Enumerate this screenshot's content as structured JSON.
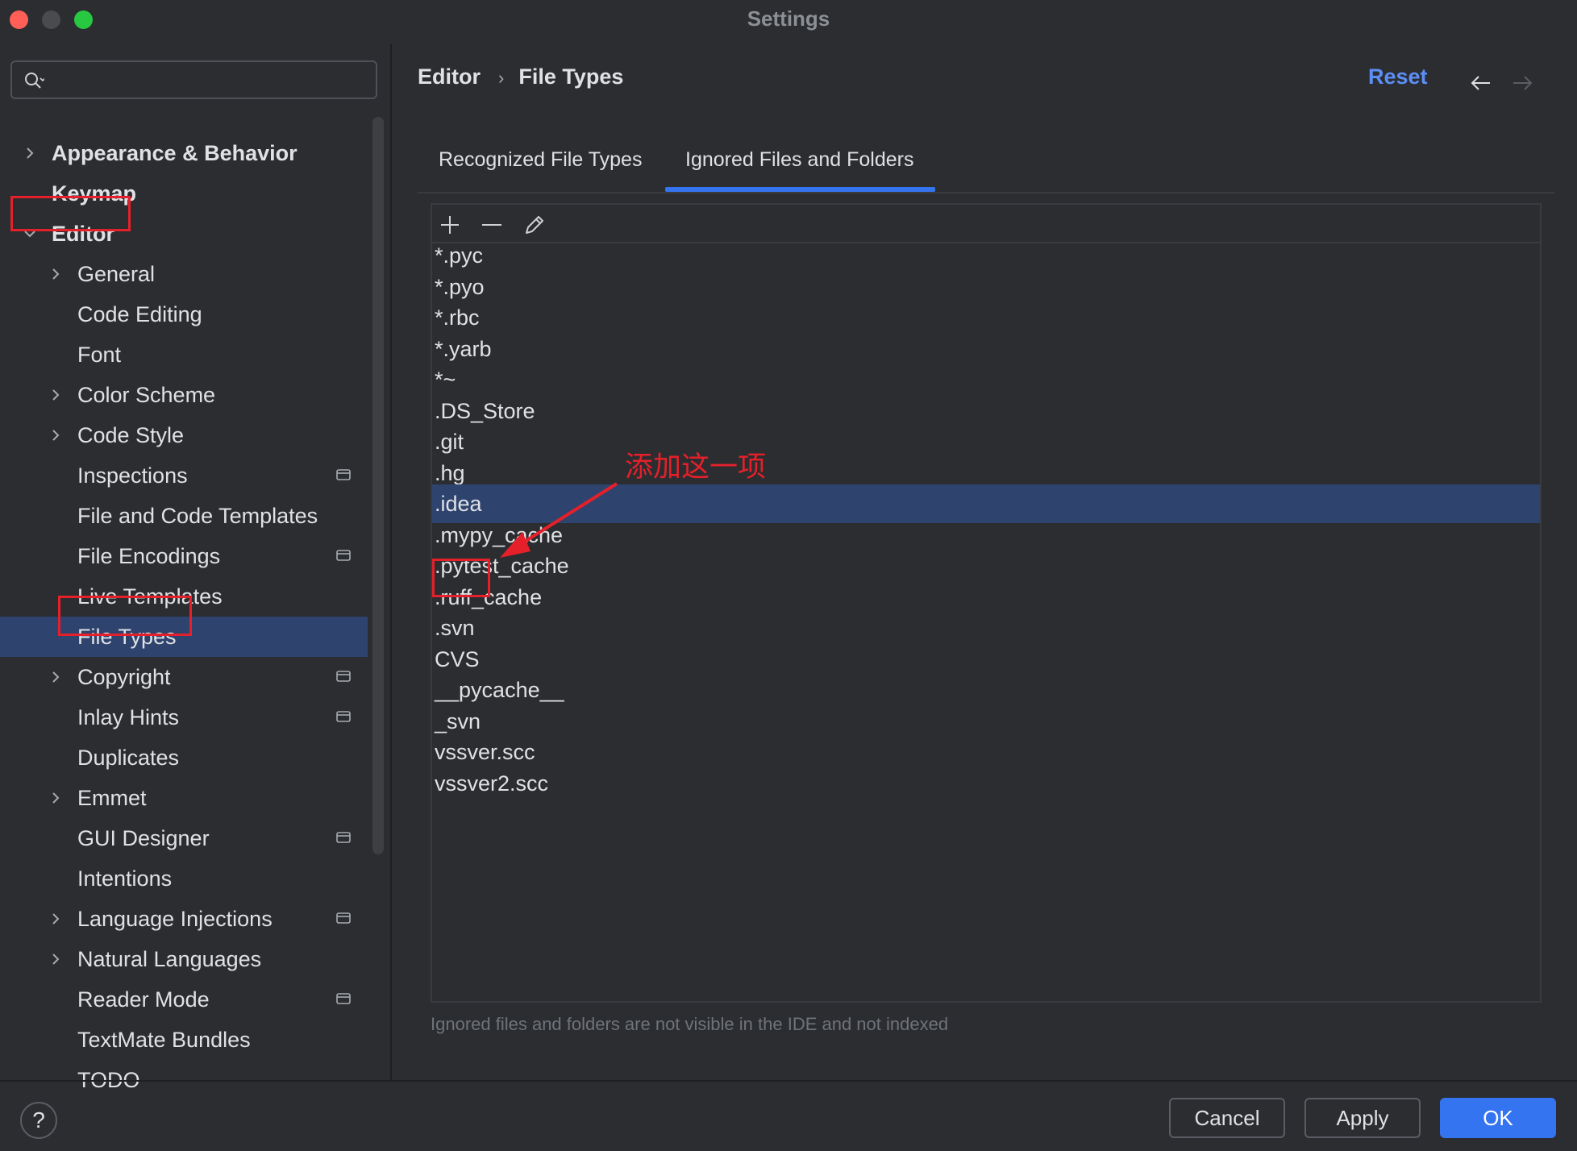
{
  "window": {
    "title": "Settings"
  },
  "search": {
    "placeholder": ""
  },
  "sidebar": {
    "items": [
      {
        "label": "Appearance & Behavior",
        "expandable": true,
        "expanded": false,
        "bold": true,
        "level": 0,
        "project_icon": false
      },
      {
        "label": "Keymap",
        "expandable": false,
        "bold": true,
        "level": 0,
        "project_icon": false
      },
      {
        "label": "Editor",
        "expandable": true,
        "expanded": true,
        "bold": true,
        "level": 0,
        "project_icon": false,
        "highlighted": true
      },
      {
        "label": "General",
        "expandable": true,
        "expanded": false,
        "level": 1,
        "project_icon": false
      },
      {
        "label": "Code Editing",
        "expandable": false,
        "level": 1,
        "project_icon": false
      },
      {
        "label": "Font",
        "expandable": false,
        "level": 1,
        "project_icon": false
      },
      {
        "label": "Color Scheme",
        "expandable": true,
        "expanded": false,
        "level": 1,
        "project_icon": false
      },
      {
        "label": "Code Style",
        "expandable": true,
        "expanded": false,
        "level": 1,
        "project_icon": false
      },
      {
        "label": "Inspections",
        "expandable": false,
        "level": 1,
        "project_icon": true
      },
      {
        "label": "File and Code Templates",
        "expandable": false,
        "level": 1,
        "project_icon": false
      },
      {
        "label": "File Encodings",
        "expandable": false,
        "level": 1,
        "project_icon": true
      },
      {
        "label": "Live Templates",
        "expandable": false,
        "level": 1,
        "project_icon": false
      },
      {
        "label": "File Types",
        "expandable": false,
        "level": 1,
        "project_icon": false,
        "selected": true,
        "highlighted": true
      },
      {
        "label": "Copyright",
        "expandable": true,
        "expanded": false,
        "level": 1,
        "project_icon": true
      },
      {
        "label": "Inlay Hints",
        "expandable": false,
        "level": 1,
        "project_icon": true
      },
      {
        "label": "Duplicates",
        "expandable": false,
        "level": 1,
        "project_icon": false
      },
      {
        "label": "Emmet",
        "expandable": true,
        "expanded": false,
        "level": 1,
        "project_icon": false
      },
      {
        "label": "GUI Designer",
        "expandable": false,
        "level": 1,
        "project_icon": true
      },
      {
        "label": "Intentions",
        "expandable": false,
        "level": 1,
        "project_icon": false
      },
      {
        "label": "Language Injections",
        "expandable": true,
        "expanded": false,
        "level": 1,
        "project_icon": true
      },
      {
        "label": "Natural Languages",
        "expandable": true,
        "expanded": false,
        "level": 1,
        "project_icon": false
      },
      {
        "label": "Reader Mode",
        "expandable": false,
        "level": 1,
        "project_icon": true
      },
      {
        "label": "TextMate Bundles",
        "expandable": false,
        "level": 1,
        "project_icon": false
      },
      {
        "label": "TODO",
        "expandable": false,
        "level": 1,
        "project_icon": false
      }
    ]
  },
  "header": {
    "breadcrumb": [
      "Editor",
      "File Types"
    ],
    "reset_label": "Reset",
    "back_icon": "arrow-left-icon",
    "forward_icon": "arrow-right-icon"
  },
  "tabs": [
    {
      "label": "Recognized File Types",
      "active": false
    },
    {
      "label": "Ignored Files and Folders",
      "active": true
    }
  ],
  "toolbar": {
    "buttons": [
      {
        "name": "add-button",
        "icon": "plus-icon"
      },
      {
        "name": "remove-button",
        "icon": "minus-icon"
      },
      {
        "name": "edit-button",
        "icon": "pencil-icon"
      }
    ]
  },
  "ignored_list": {
    "entries": [
      "*.pyc",
      "*.pyo",
      "*.rbc",
      "*.yarb",
      "*~",
      ".DS_Store",
      ".git",
      ".hg",
      ".idea",
      ".mypy_cache",
      ".pytest_cache",
      ".ruff_cache",
      ".svn",
      "CVS",
      "__pycache__",
      "_svn",
      "vssver.scc",
      "vssver2.scc"
    ],
    "selected": ".idea"
  },
  "annotation": {
    "text": "添加这一项"
  },
  "hint": "Ignored files and folders are not visible in the IDE and not indexed",
  "footer": {
    "help_label": "?",
    "cancel_label": "Cancel",
    "apply_label": "Apply",
    "ok_label": "OK"
  },
  "colors": {
    "background": "#2b2d30",
    "selection": "#2e436e",
    "accent": "#3574f0",
    "link": "#5c8ef5",
    "annotation": "#e5202a"
  }
}
